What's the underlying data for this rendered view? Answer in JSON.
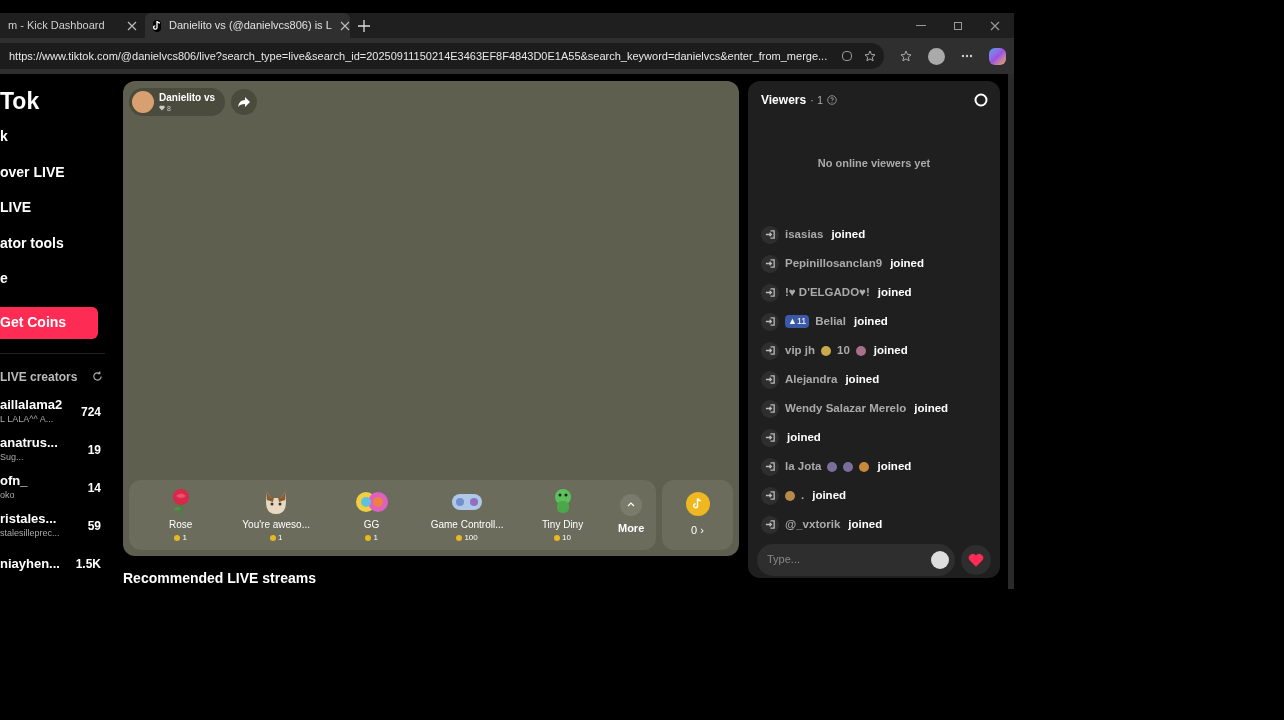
{
  "browser": {
    "tabs": [
      {
        "title": "m - Kick Dashboard",
        "selected": false
      },
      {
        "title": "Danielito vs (@danielvcs806) is L",
        "selected": true
      }
    ],
    "url": "https://www.tiktok.com/@danielvcs806/live?search_type=live&search_id=20250911150214E3463EF8F4843D0E1A55&search_keyword=danielvcs&enter_from_merge..."
  },
  "sidebar": {
    "logo": "Tok",
    "nav": [
      {
        "label": "k",
        "selected": false
      },
      {
        "label": "over LIVE",
        "selected": false
      },
      {
        "label": "LIVE",
        "selected": false
      },
      {
        "label": "ator tools",
        "selected": false
      },
      {
        "label": "e",
        "selected": false
      }
    ],
    "coins_button": "Get Coins",
    "creators_title": "LIVE creators",
    "creators": [
      {
        "name": "aillalama2",
        "subtitle": "L LALA^^ A...",
        "count": "724"
      },
      {
        "name": "anatrus...",
        "subtitle": "Sug...",
        "count": "19"
      },
      {
        "name": "ofn_",
        "subtitle": "oko",
        "count": "14"
      },
      {
        "name": "ristales...",
        "subtitle": "stalesillepreс...",
        "count": "59"
      },
      {
        "name": "niayhen...",
        "count": "1.5K"
      }
    ]
  },
  "stream": {
    "host": "Danielito vs",
    "likes": "8",
    "gifts": [
      {
        "kind": "rose",
        "name": "Rose",
        "price": "1"
      },
      {
        "kind": "cat",
        "name": "You're aweso...",
        "price": "1"
      },
      {
        "kind": "gg",
        "name": "GG",
        "price": "1"
      },
      {
        "kind": "controller",
        "name": "Game Controll...",
        "price": "100"
      },
      {
        "kind": "dino",
        "name": "Tiny Diny",
        "price": "10"
      }
    ],
    "more": "More",
    "balance": "0 ›"
  },
  "recommended_title": "Recommended LIVE streams",
  "viewers": {
    "title": "Viewers",
    "count": "· 1",
    "empty": "No online viewers yet",
    "joins": [
      {
        "parts": [
          {
            "kind": "text",
            "text": "isasias"
          }
        ],
        "action": "joined"
      },
      {
        "parts": [
          {
            "kind": "text",
            "text": "Pepinillosanclan9"
          }
        ],
        "action": "joined"
      },
      {
        "parts": [
          {
            "kind": "text",
            "text": "!♥ D'ELGADO♥!"
          }
        ],
        "action": "joined"
      },
      {
        "parts": [
          {
            "kind": "badge",
            "text": "▲11"
          },
          {
            "kind": "text",
            "text": "Belial"
          }
        ],
        "action": "joined"
      },
      {
        "parts": [
          {
            "kind": "text",
            "text": "vip jh"
          },
          {
            "kind": "emoji",
            "color": "#c9a94a"
          },
          {
            "kind": "text",
            "text": "10"
          },
          {
            "kind": "emoji",
            "color": "#a8708a"
          }
        ],
        "action": "joined"
      },
      {
        "parts": [
          {
            "kind": "text",
            "text": "Alejandra"
          }
        ],
        "action": "joined"
      },
      {
        "parts": [
          {
            "kind": "text",
            "text": "Wendy Salazar Merelo"
          }
        ],
        "action": "joined"
      },
      {
        "action": "joined"
      },
      {
        "parts": [
          {
            "kind": "text",
            "text": "la Jota"
          },
          {
            "kind": "emoji",
            "color": "#7a6e9a"
          },
          {
            "kind": "emoji",
            "color": "#7a6e9a"
          },
          {
            "kind": "emoji",
            "color": "#c88a3a"
          }
        ],
        "action": "joined"
      },
      {
        "parts": [
          {
            "kind": "emoji",
            "color": "#b58a4a"
          },
          {
            "kind": "text",
            "text": "."
          }
        ],
        "action": "joined"
      },
      {
        "parts": [
          {
            "kind": "text",
            "text": "@_vxtorik"
          }
        ],
        "action": "joined"
      }
    ],
    "input_placeholder": "Type..."
  }
}
